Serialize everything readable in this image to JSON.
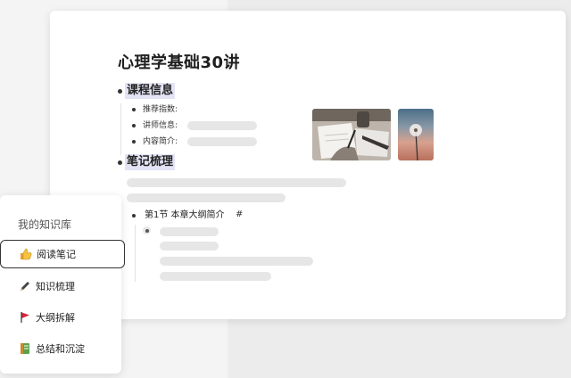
{
  "doc": {
    "title": "心理学基础30讲",
    "course_section": {
      "heading": "课程信息",
      "props": [
        "推荐指数:",
        "讲师信息:",
        "内容简介:"
      ]
    },
    "notes_section": {
      "heading": "笔记梳理",
      "chapter": "第1节 本章大纲简介",
      "hash": "#"
    },
    "images": [
      {
        "icon": "writing-photo"
      },
      {
        "icon": "dandelion-photo"
      }
    ]
  },
  "menu": {
    "title": "我的知识库",
    "items": [
      {
        "label": "阅读笔记",
        "icon": "thumbs-up-icon",
        "active": true
      },
      {
        "label": "知识梳理",
        "icon": "pencil-icon",
        "active": false
      },
      {
        "label": "大纲拆解",
        "icon": "flag-icon",
        "active": false
      },
      {
        "label": "总结和沉淀",
        "icon": "ledger-icon",
        "active": false
      }
    ]
  },
  "colors": {
    "heading_highlight": "#e3e3f5",
    "skeleton": "#e6e6e6"
  }
}
